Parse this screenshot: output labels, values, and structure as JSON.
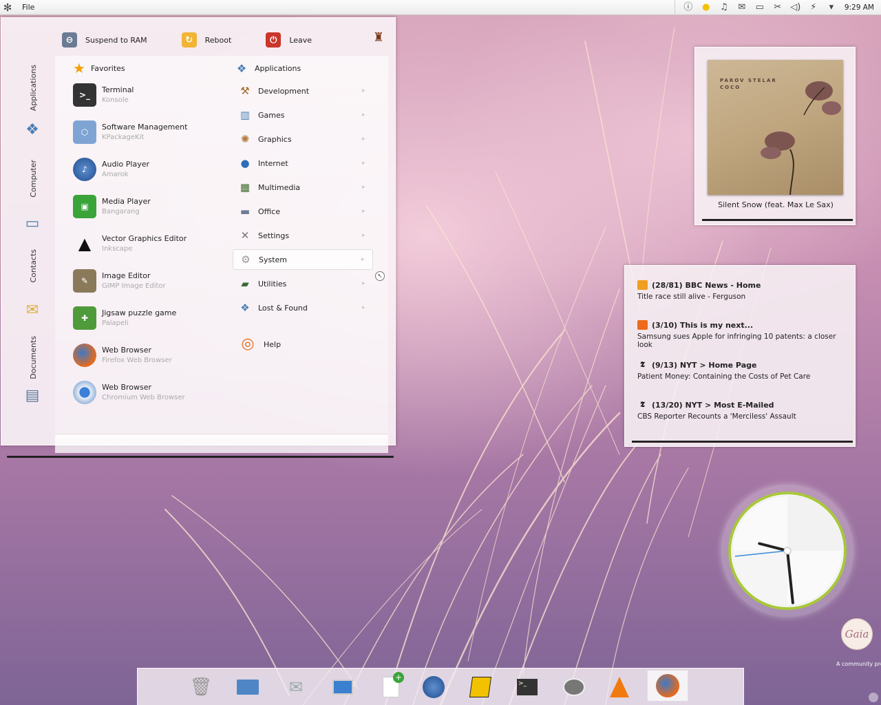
{
  "panel": {
    "kicker_icon": "gear-icon",
    "file_menu": "File",
    "tray_icons": [
      "info-icon",
      "weather-icon",
      "notes-icon",
      "mail-icon",
      "chat-icon",
      "network-icon",
      "volume-icon",
      "bluetooth-icon",
      "arrow-down-icon"
    ],
    "time": "9:29 AM"
  },
  "launcher": {
    "side_tabs": [
      {
        "label": "Applications",
        "icon": "applications-icon"
      },
      {
        "label": "Computer",
        "icon": "laptop-icon"
      },
      {
        "label": "Contacts",
        "icon": "contacts-icon"
      },
      {
        "label": "Documents",
        "icon": "printer-icon"
      }
    ],
    "top_actions": [
      {
        "label": "Suspend to RAM",
        "icon": "suspend-icon"
      },
      {
        "label": "Reboot",
        "icon": "reboot-icon"
      },
      {
        "label": "Leave",
        "icon": "leave-icon"
      }
    ],
    "favorites_header": "Favorites",
    "favorites": [
      {
        "name": "Terminal",
        "sub": "Konsole"
      },
      {
        "name": "Software Management",
        "sub": "KPackageKit"
      },
      {
        "name": "Audio Player",
        "sub": "Amarok"
      },
      {
        "name": "Media Player",
        "sub": "Bangarang"
      },
      {
        "name": "Vector Graphics Editor",
        "sub": "Inkscape"
      },
      {
        "name": "Image Editor",
        "sub": "GIMP Image Editor"
      },
      {
        "name": "Jigsaw puzzle game",
        "sub": "Palapeli"
      },
      {
        "name": "Web Browser",
        "sub": "Firefox Web Browser"
      },
      {
        "name": "Web Browser",
        "sub": "Chromium Web Browser"
      }
    ],
    "categories_header": "Applications",
    "categories": [
      {
        "label": "Development"
      },
      {
        "label": "Games"
      },
      {
        "label": "Graphics"
      },
      {
        "label": "Internet"
      },
      {
        "label": "Multimedia"
      },
      {
        "label": "Office"
      },
      {
        "label": "Settings"
      },
      {
        "label": "System"
      },
      {
        "label": "Utilities"
      },
      {
        "label": "Lost & Found"
      },
      {
        "label": "Help"
      }
    ]
  },
  "now_playing": {
    "cover_artist": "PAROV STELAR",
    "cover_album": "COCO",
    "title": "Silent Snow (feat. Max Le Sax)"
  },
  "news": [
    {
      "header": "(28/81) BBC News - Home",
      "body": "Title race still alive - Ferguson",
      "color": "#f0a020"
    },
    {
      "header": "(3/10) This is my next...",
      "body": "Samsung sues Apple for infringing 10 patents: a closer look",
      "color": "#ee6a1a"
    },
    {
      "header": "(9/13) NYT > Home Page",
      "body": "Patient Money: Containing the Costs of Pet Care",
      "glyph": "𝕿"
    },
    {
      "header": "(13/20) NYT > Most E-Mailed",
      "body": "CBS Reporter Recounts a 'Merciless' Assault",
      "glyph": "𝕿"
    }
  ],
  "clock": {
    "time": "9:29"
  },
  "branding": {
    "logo_text": "Gaia",
    "community_text": "A community project"
  },
  "dock": [
    "trash-icon",
    "folder-icon",
    "mail-icon",
    "computer-icon",
    "new-note-icon",
    "amarok-icon",
    "notes-pen-icon",
    "terminal-icon",
    "messaging-icon",
    "vlc-icon",
    "firefox-icon"
  ]
}
